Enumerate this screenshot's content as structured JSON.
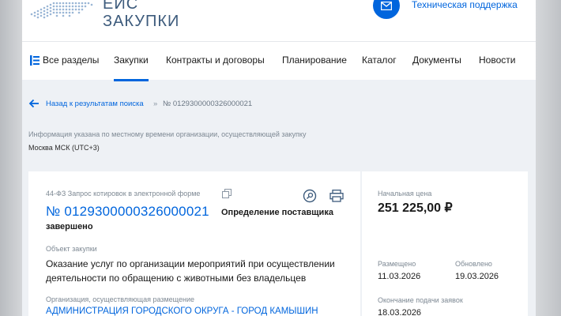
{
  "header": {
    "logo_line1": "ЕИС",
    "logo_line2": "ЗАКУПКИ",
    "support_label": "Техническая поддержка"
  },
  "nav": {
    "items": [
      {
        "label": "Все разделы"
      },
      {
        "label": "Закупки"
      },
      {
        "label": "Контракты и договоры"
      },
      {
        "label": "Планирование"
      },
      {
        "label": "Каталог"
      },
      {
        "label": "Документы"
      },
      {
        "label": "Новости"
      }
    ],
    "active_index": 1
  },
  "breadcrumb": {
    "back_label": "Назад к результатам поиска",
    "separator": "»",
    "current": "№ 0129300000326000021"
  },
  "timezone": {
    "info": "Информация указана по местному времени организации, осуществляющей закупку",
    "value": "Москва МСК (UTC+3)"
  },
  "procurement": {
    "type": "44-ФЗ Запрос котировок в электронной форме",
    "number": "№ 0129300000326000021",
    "status_line1": "Определение поставщика",
    "status_line2": "завершено",
    "object_label": "Объект закупки",
    "object_value": "Оказание услуг по организации мероприятий при осуществлении деятельности по обращению с животными без владельцев",
    "org_label": "Организация, осуществляющая размещение",
    "org_value": "АДМИНИСТРАЦИЯ ГОРОДСКОГО ОКРУГА - ГОРОД КАМЫШИН"
  },
  "summary": {
    "price_label": "Начальная цена",
    "price_value": "251 225,00 ₽",
    "published_label": "Размещено",
    "published_value": "11.03.2026",
    "updated_label": "Обновлено",
    "updated_value": "19.03.2026",
    "deadline_label": "Окончание подачи заявок",
    "deadline_value": "18.03.2026"
  },
  "colors": {
    "accent": "#0065dd",
    "muted_text": "#7d8893",
    "page_bg": "#eef1f5"
  }
}
